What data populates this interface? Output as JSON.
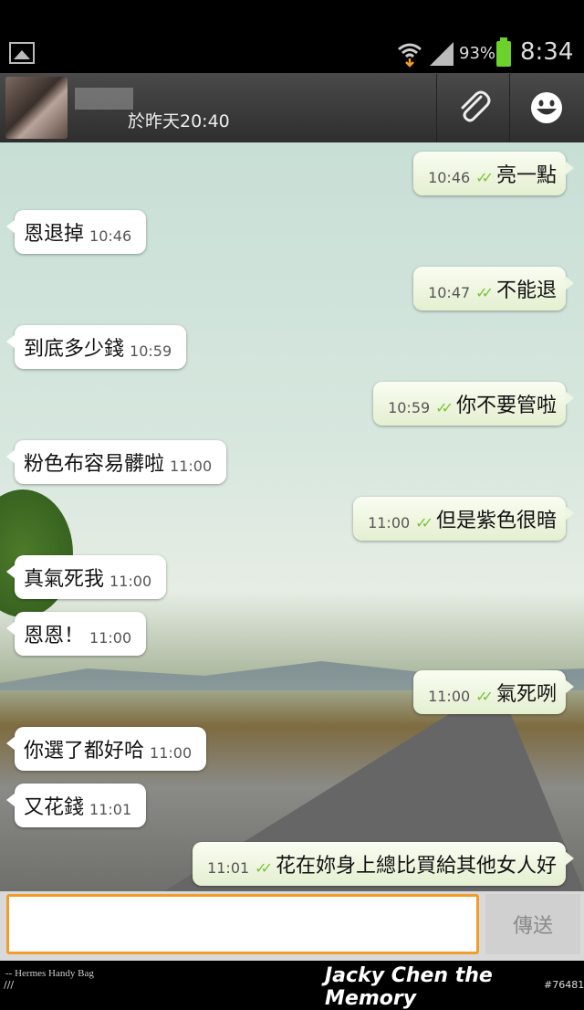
{
  "status_bar": {
    "battery": "93%",
    "time": "8:34"
  },
  "header": {
    "last_seen": "於昨天20:40"
  },
  "colors": {
    "accent_orange": "#f29d2a",
    "check_green": "#7cc13a"
  },
  "messages": [
    {
      "dir": "out",
      "time": "10:46",
      "text": "亮一點"
    },
    {
      "dir": "in",
      "time": "10:46",
      "text": "恩退掉"
    },
    {
      "dir": "out",
      "time": "10:47",
      "text": "不能退"
    },
    {
      "dir": "in",
      "time": "10:59",
      "text": "到底多少錢"
    },
    {
      "dir": "out",
      "time": "10:59",
      "text": "你不要管啦"
    },
    {
      "dir": "in",
      "time": "11:00",
      "text": "粉色布容易髒啦"
    },
    {
      "dir": "out",
      "time": "11:00",
      "text": "但是紫色很暗"
    },
    {
      "dir": "in",
      "time": "11:00",
      "text": "真氣死我"
    },
    {
      "dir": "in",
      "time": "11:00",
      "text": "恩恩！"
    },
    {
      "dir": "out",
      "time": "11:00",
      "text": "氣死咧"
    },
    {
      "dir": "in",
      "time": "11:00",
      "text": "你選了都好哈"
    },
    {
      "dir": "in",
      "time": "11:01",
      "text": "又花錢"
    },
    {
      "dir": "out",
      "time": "11:01",
      "text": "花在妳身上總比買給其他女人好"
    }
  ],
  "composer": {
    "send_label": "傳送"
  },
  "footer": {
    "caption": "-- Hermes Handy Bag",
    "slashes": "///",
    "watermark": "Jacky Chen the Memory",
    "post_id": "#76481"
  }
}
